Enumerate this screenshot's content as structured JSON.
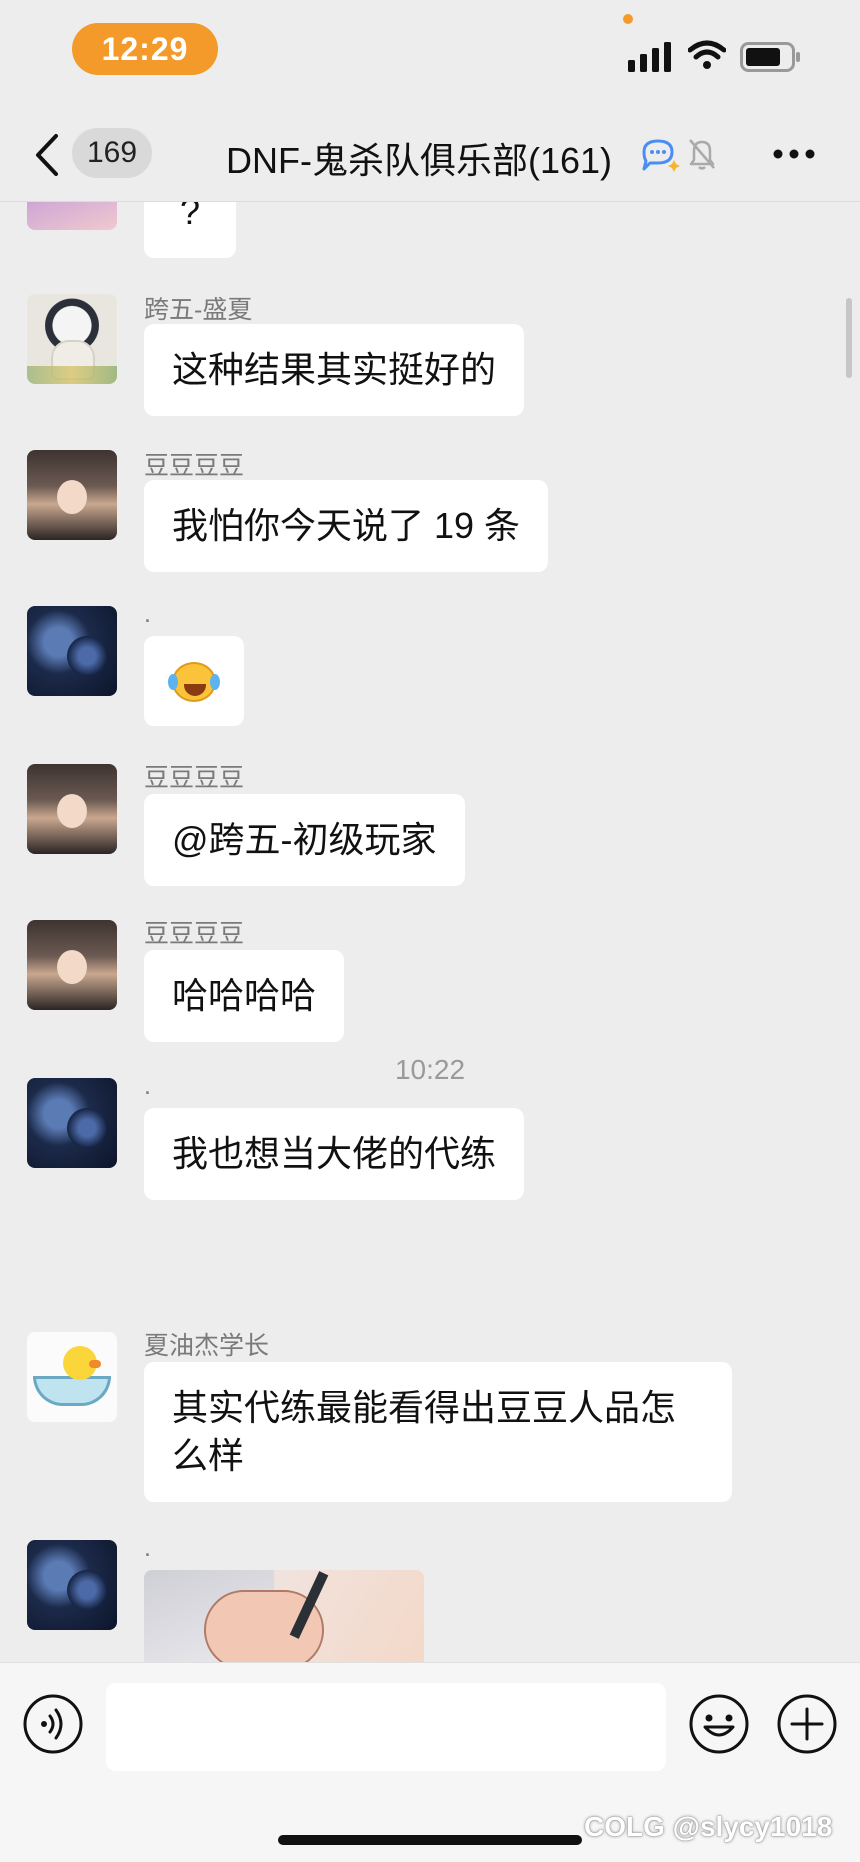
{
  "status_bar": {
    "time": "12:29"
  },
  "nav": {
    "unread_count": "169",
    "title": "DNF-鬼杀队俱乐部(161)"
  },
  "messages": [
    {
      "sender": "",
      "text": "?",
      "avatar": "cartoon-avatar"
    },
    {
      "sender": "跨五-盛夏",
      "text": "这种结果其实挺好的",
      "avatar": "astronaut-avatar"
    },
    {
      "sender": "豆豆豆豆",
      "text": "我怕你今天说了 19 条",
      "avatar": "girl-avatar"
    },
    {
      "sender": ".",
      "text": "😭",
      "avatar": "dark-blue-avatar"
    },
    {
      "sender": "豆豆豆豆",
      "text": "@跨五-初级玩家",
      "avatar": "girl-avatar"
    },
    {
      "sender": "豆豆豆豆",
      "text": "哈哈哈哈",
      "avatar": "girl-avatar"
    },
    {
      "sender": ".",
      "text": "我也想当大佬的代练",
      "avatar": "dark-blue-avatar"
    },
    {
      "sender": "夏油杰学长",
      "text_line1": "其实代练最能看得出豆豆人品怎",
      "text_line2": "么样",
      "avatar": "duck-bath-avatar"
    },
    {
      "sender": ".",
      "text": "",
      "avatar": "dark-blue-avatar",
      "image": "anime-image"
    }
  ],
  "time_separator": "10:22",
  "input": {
    "placeholder": ""
  },
  "watermark": "COLG @slycy1018",
  "colors": {
    "accent": "#f39a2b",
    "background": "#ededed",
    "bubble": "#ffffff"
  }
}
